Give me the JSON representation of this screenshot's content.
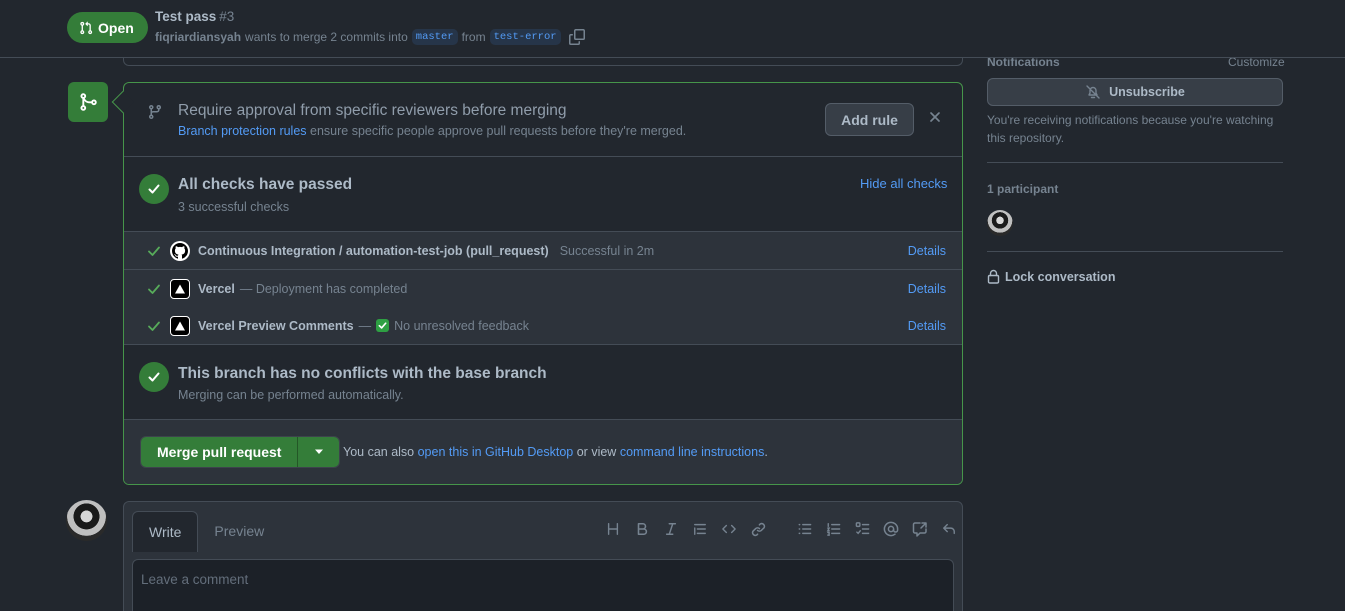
{
  "header": {
    "state_label": "Open",
    "title": "Test pass",
    "number": "#3",
    "author": "fiqriardiansyah",
    "meta_text": "wants to merge 2 commits into",
    "base_branch": "master",
    "from_text": "from",
    "head_branch": "test-error"
  },
  "approval": {
    "title": "Require approval from specific reviewers before merging",
    "link_text": "Branch protection rules",
    "desc": "ensure specific people approve pull requests before they're merged.",
    "add_rule_label": "Add rule"
  },
  "checks": {
    "title": "All checks have passed",
    "subtitle": "3 successful checks",
    "hide_label": "Hide all checks",
    "rows": [
      {
        "name": "Continuous Integration / automation-test-job (pull_request)",
        "status": "Successful in 2m",
        "details": "Details",
        "logo": "github-icon"
      },
      {
        "name": "Vercel",
        "status": "— Deployment has completed",
        "details": "Details",
        "logo": "vercel-icon"
      },
      {
        "name": "Vercel Preview Comments",
        "separator": "—",
        "status": "No unresolved feedback",
        "details": "Details",
        "logo": "vercel-icon"
      }
    ]
  },
  "conflicts": {
    "title": "This branch has no conflicts with the base branch",
    "subtitle": "Merging can be performed automatically."
  },
  "merge": {
    "button_label": "Merge pull request",
    "hint_prefix": "You can also",
    "desktop_link": "open this in GitHub Desktop",
    "hint_mid": "or view",
    "cli_link": "command line instructions",
    "hint_suffix": "."
  },
  "comment": {
    "tab_write": "Write",
    "tab_preview": "Preview",
    "placeholder": "Leave a comment",
    "toolbar_icons": [
      "heading-icon",
      "bold-icon",
      "italic-icon",
      "quote-icon",
      "code-icon",
      "link-icon",
      "unordered-list-icon",
      "ordered-list-icon",
      "task-list-icon",
      "mention-icon",
      "cross-reference-icon",
      "reply-icon"
    ]
  },
  "sidebar": {
    "notifications_label": "Notifications",
    "customize_label": "Customize",
    "unsubscribe_label": "Unsubscribe",
    "notification_note": "You're receiving notifications because you're watching this repository.",
    "participants_label": "1 participant",
    "lock_label": "Lock conversation"
  },
  "colors": {
    "accent_green": "#347d39",
    "link_blue": "#539bf5",
    "background": "#22272e"
  }
}
